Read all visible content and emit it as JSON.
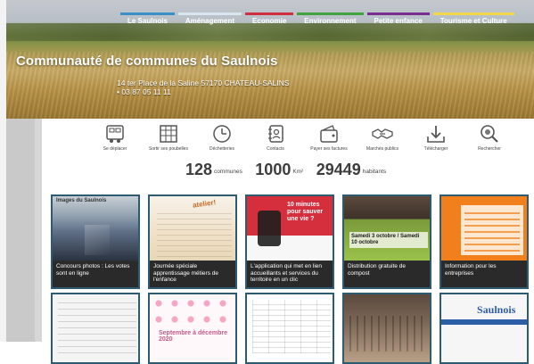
{
  "nav": {
    "items": [
      {
        "label": "Le Saulnois",
        "color": "#3a8fc8"
      },
      {
        "label": "Aménagement",
        "color": "#d7e7ef"
      },
      {
        "label": "Economie",
        "color": "#d02f41"
      },
      {
        "label": "Environnement",
        "color": "#41a23f"
      },
      {
        "label": "Petite enfance",
        "color": "#7a2d8f"
      },
      {
        "label": "Tourisme et Culture",
        "color": "#f1d84a"
      }
    ]
  },
  "site": {
    "title": "Communauté de communes du Saulnois",
    "address": "14 ter Place de la Saline 57170 CHATEAU-SALINS",
    "phone": "03 87 05 11 11"
  },
  "quicklinks": {
    "items": [
      {
        "label": "Se déplacer",
        "icon": "bus-icon"
      },
      {
        "label": "Sortir ses poubelles",
        "icon": "calendar-grid-icon"
      },
      {
        "label": "Déchetteries",
        "icon": "clock-icon"
      },
      {
        "label": "Contacts",
        "icon": "address-book-icon"
      },
      {
        "label": "Payer ses factures",
        "icon": "wallet-icon"
      },
      {
        "label": "Marchés publics",
        "icon": "handshake-icon"
      },
      {
        "label": "Télécharger",
        "icon": "download-icon"
      },
      {
        "label": "Rechercher",
        "icon": "search-icon"
      }
    ]
  },
  "stats": {
    "communes_value": "128",
    "communes_unit": "communes",
    "area_value": "1000",
    "area_unit": "Km²",
    "population_value": "29449",
    "population_unit": "habitants"
  },
  "cards": {
    "row1": [
      {
        "caption": "Concours photos : Les votes sont en ligne",
        "theme": "photo",
        "top_text": "Images du Saulnois"
      },
      {
        "caption": "Journée spéciale apprentissage métiers de l'enfance",
        "theme": "poster",
        "top_text": "atelier!"
      },
      {
        "caption": "L'application qui met en lien accueillants et services du territoire en un clic",
        "theme": "red",
        "top_text": "10 minutes pour sauver une vie ?"
      },
      {
        "caption": "Distribution gratuite de compost",
        "theme": "green",
        "top_text": "Samedi 3 octobre / Samedi 10 octobre"
      },
      {
        "caption": "Information pour les entreprises",
        "theme": "orange",
        "top_text": ""
      }
    ],
    "row2": [
      {
        "theme": "doc"
      },
      {
        "theme": "program",
        "top_text": "Septembre à décembre 2020"
      },
      {
        "theme": "table"
      },
      {
        "theme": "hall"
      },
      {
        "theme": "newsletter",
        "top_text": "Saulnois"
      }
    ]
  }
}
